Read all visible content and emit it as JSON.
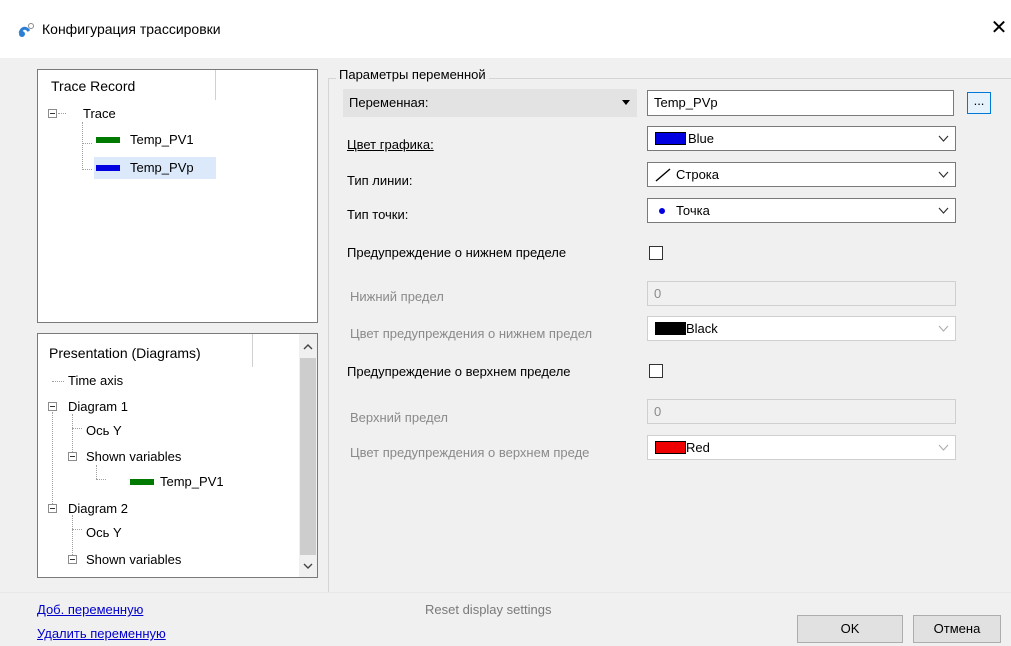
{
  "window": {
    "title": "Конфигурация трассировки",
    "close_glyph": "✕"
  },
  "trace_record": {
    "header": "Trace Record",
    "root": "Trace",
    "items": [
      {
        "label": "Temp_PV1",
        "color": "#007a00"
      },
      {
        "label": "Temp_PVp",
        "color": "#0000e0",
        "selected": true
      }
    ]
  },
  "presentation": {
    "header": "Presentation (Diagrams)",
    "nodes": [
      {
        "label": "Time axis"
      },
      {
        "label": "Diagram 1"
      },
      {
        "label": "Ось Y"
      },
      {
        "label": "Shown variables"
      },
      {
        "label": "Temp_PV1",
        "color": "#007a00"
      },
      {
        "label": "Diagram 2"
      },
      {
        "label": "Ось Y"
      },
      {
        "label": "Shown variables"
      }
    ]
  },
  "params": {
    "group_title": "Параметры переменной",
    "variable": {
      "label": "Переменная:",
      "value": "Temp_PVp",
      "browse": "..."
    },
    "graph_color": {
      "label": "Цвет графика:",
      "value": "Blue",
      "swatch": "#0000e0"
    },
    "line_type": {
      "label": "Тип линии:",
      "value": "Строка"
    },
    "point_type": {
      "label": "Тип точки:",
      "value": "Точка"
    },
    "low_warn": {
      "label": "Предупреждение о нижнем пределе",
      "checked": false
    },
    "low_limit": {
      "label": "Нижний предел",
      "value": "0"
    },
    "low_color": {
      "label": "Цвет предупреждения о нижнем предел",
      "value": "Black",
      "swatch": "#000000"
    },
    "high_warn": {
      "label": "Предупреждение о верхнем пределе",
      "checked": false
    },
    "high_limit": {
      "label": "Верхний предел",
      "value": "0"
    },
    "high_color": {
      "label": "Цвет предупреждения о верхнем преде",
      "value": "Red",
      "swatch": "#ee0000"
    }
  },
  "footer": {
    "add_var": "Доб. переменную",
    "remove_var": "Удалить переменную",
    "reset": "Reset display settings",
    "ok": "OK",
    "cancel": "Отмена"
  }
}
